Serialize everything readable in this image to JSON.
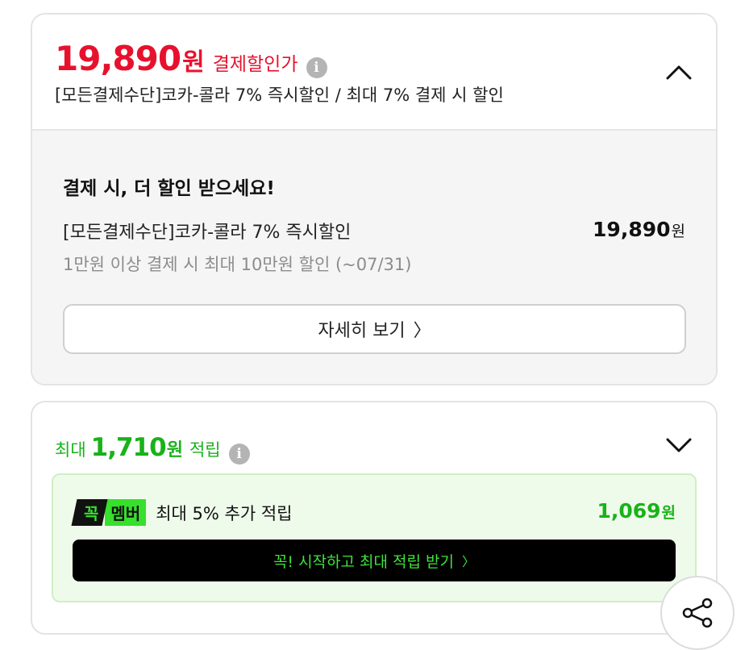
{
  "price_card": {
    "price": "19,890",
    "unit": "원",
    "label": "결제할인가",
    "info_glyph": "i",
    "description": "[모든결제수단]코카-콜라 7% 즉시할인 / 최대 7% 결제 시 할인",
    "toggle_icon": "chevron-up-icon",
    "promo": {
      "title": "결제 시, 더 할인 받으세요!",
      "name": "[모든결제수단]코카-콜라 7% 즉시할인",
      "condition": "1만원 이상 결제 시 최대 10만원 할인 (~07/31)",
      "price": "19,890",
      "unit": "원"
    },
    "detail_button": {
      "label": "자세히 보기",
      "arrow": "〉"
    }
  },
  "reward_card": {
    "prefix": "최대",
    "amount": "1,710",
    "unit": "원",
    "suffix": "적립",
    "info_glyph": "i",
    "toggle_icon": "chevron-down-icon",
    "member": {
      "badge_part1": "꼭",
      "badge_part2": "멤버",
      "text": "최대 5% 추가 적립",
      "amount": "1,069",
      "unit": "원",
      "button_label": "꼭! 시작하고 최대 적립 받기",
      "button_arrow": "〉"
    }
  },
  "colors": {
    "price_red": "#e8112d",
    "reward_green": "#19b219",
    "member_green": "#36e02c",
    "member_box_bg": "#effbea"
  },
  "share": {
    "icon": "share-icon"
  }
}
